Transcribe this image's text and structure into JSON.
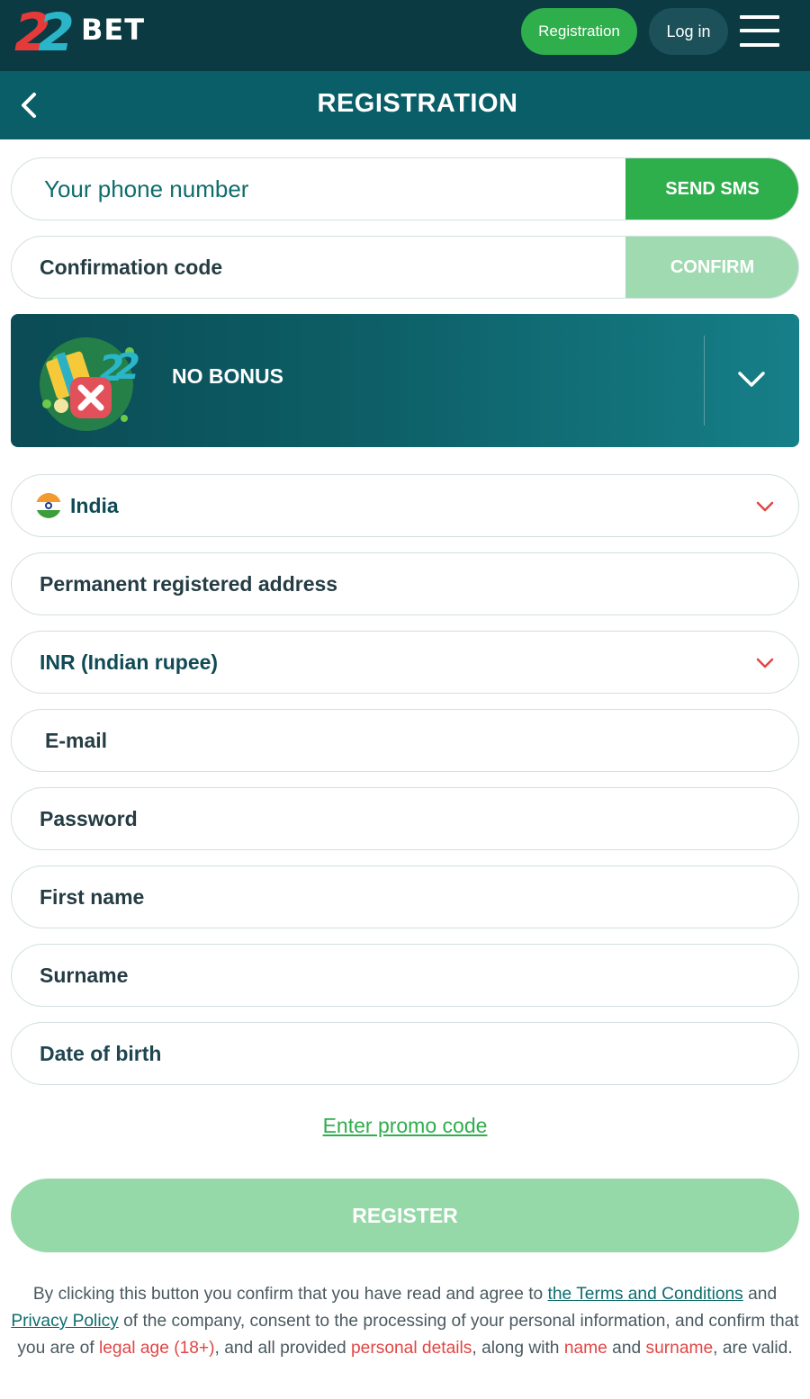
{
  "header": {
    "logo_digits": "22",
    "logo_text": "BET",
    "registration_label": "Registration",
    "login_label": "Log in"
  },
  "titlebar": {
    "title": "REGISTRATION"
  },
  "form": {
    "phone_placeholder": "Your phone number",
    "send_sms_label": "SEND SMS",
    "confirmation_code_label": "Confirmation code",
    "confirm_label": "CONFIRM",
    "bonus_label": "NO BONUS",
    "country": "India",
    "address_label": "Permanent registered address",
    "currency": "INR (Indian rupee)",
    "email_label": "E-mail",
    "password_label": "Password",
    "first_name_label": "First name",
    "surname_label": "Surname",
    "dob_label": "Date of birth",
    "promo_label": "Enter promo code",
    "register_label": "REGISTER"
  },
  "terms": {
    "t1": "By clicking this button you confirm that you have read and agree to ",
    "link_terms": "the Terms and Conditions",
    "t2": " and ",
    "link_privacy": "Privacy Policy",
    "t3": " of the company, consent to the processing of your personal information, and confirm that you are of ",
    "legal_age": "legal age (18+)",
    "t4": ", and all provided ",
    "personal_details": "personal details",
    "t5": ", along with ",
    "name": "name",
    "t6": " and ",
    "surname": "surname",
    "t7": ", are valid."
  },
  "colors": {
    "header_bg": "#0b3a43",
    "title_bg": "#095e68",
    "green": "#2fae4c",
    "accent_red": "#e24545"
  }
}
